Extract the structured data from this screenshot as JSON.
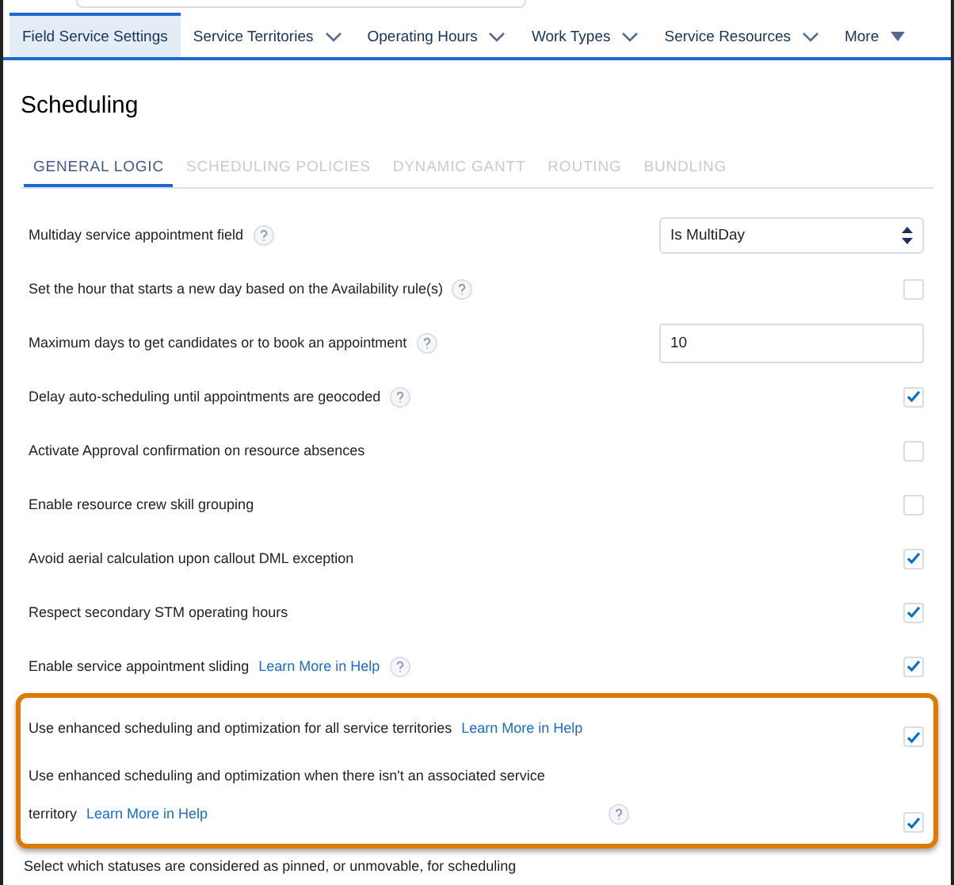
{
  "nav_tabs": [
    {
      "label": "Field Service Settings",
      "selected": true,
      "dropdown": false
    },
    {
      "label": "Service Territories",
      "selected": false,
      "dropdown": true
    },
    {
      "label": "Operating Hours",
      "selected": false,
      "dropdown": true
    },
    {
      "label": "Work Types",
      "selected": false,
      "dropdown": true
    },
    {
      "label": "Service Resources",
      "selected": false,
      "dropdown": true
    },
    {
      "label": "More",
      "selected": false,
      "dropdown": true
    }
  ],
  "page_title": "Scheduling",
  "sub_tabs": [
    {
      "label": "GENERAL LOGIC",
      "selected": true
    },
    {
      "label": "SCHEDULING POLICIES",
      "selected": false
    },
    {
      "label": "DYNAMIC GANTT",
      "selected": false
    },
    {
      "label": "ROUTING",
      "selected": false
    },
    {
      "label": "BUNDLING",
      "selected": false
    }
  ],
  "settings": [
    {
      "kind": "select",
      "label": "Multiday service appointment field",
      "help": true,
      "value": "Is MultiDay"
    },
    {
      "kind": "checkbox",
      "label": "Set the hour that starts a new day based on the Availability rule(s)",
      "help": true,
      "checked": false
    },
    {
      "kind": "input",
      "label": "Maximum days to get candidates or to book an appointment",
      "help": true,
      "value": "10"
    },
    {
      "kind": "checkbox",
      "label": "Delay auto-scheduling until appointments are geocoded",
      "help": true,
      "checked": true
    },
    {
      "kind": "checkbox",
      "label": "Activate Approval confirmation on resource absences",
      "help": false,
      "checked": false
    },
    {
      "kind": "checkbox",
      "label": "Enable resource crew skill grouping",
      "help": false,
      "checked": false
    },
    {
      "kind": "checkbox",
      "label": "Avoid aerial calculation upon callout DML exception",
      "help": false,
      "checked": true
    },
    {
      "kind": "checkbox",
      "label": "Respect secondary STM operating hours",
      "help": false,
      "checked": true
    },
    {
      "kind": "checkbox",
      "label": "Enable service appointment sliding",
      "link": "Learn More in Help",
      "help": true,
      "checked": true
    }
  ],
  "highlighted_settings": [
    {
      "kind": "checkbox",
      "label": "Use enhanced scheduling and optimization for all service territories",
      "link": "Learn More in Help",
      "help": false,
      "checked": true
    },
    {
      "kind": "checkbox",
      "label": "Use enhanced scheduling and optimization when there isn't an associated service territory",
      "link": "Learn More in Help",
      "help": true,
      "checked": true
    }
  ],
  "footer_text": "Select which statuses are considered as pinned, or unmovable, for scheduling"
}
